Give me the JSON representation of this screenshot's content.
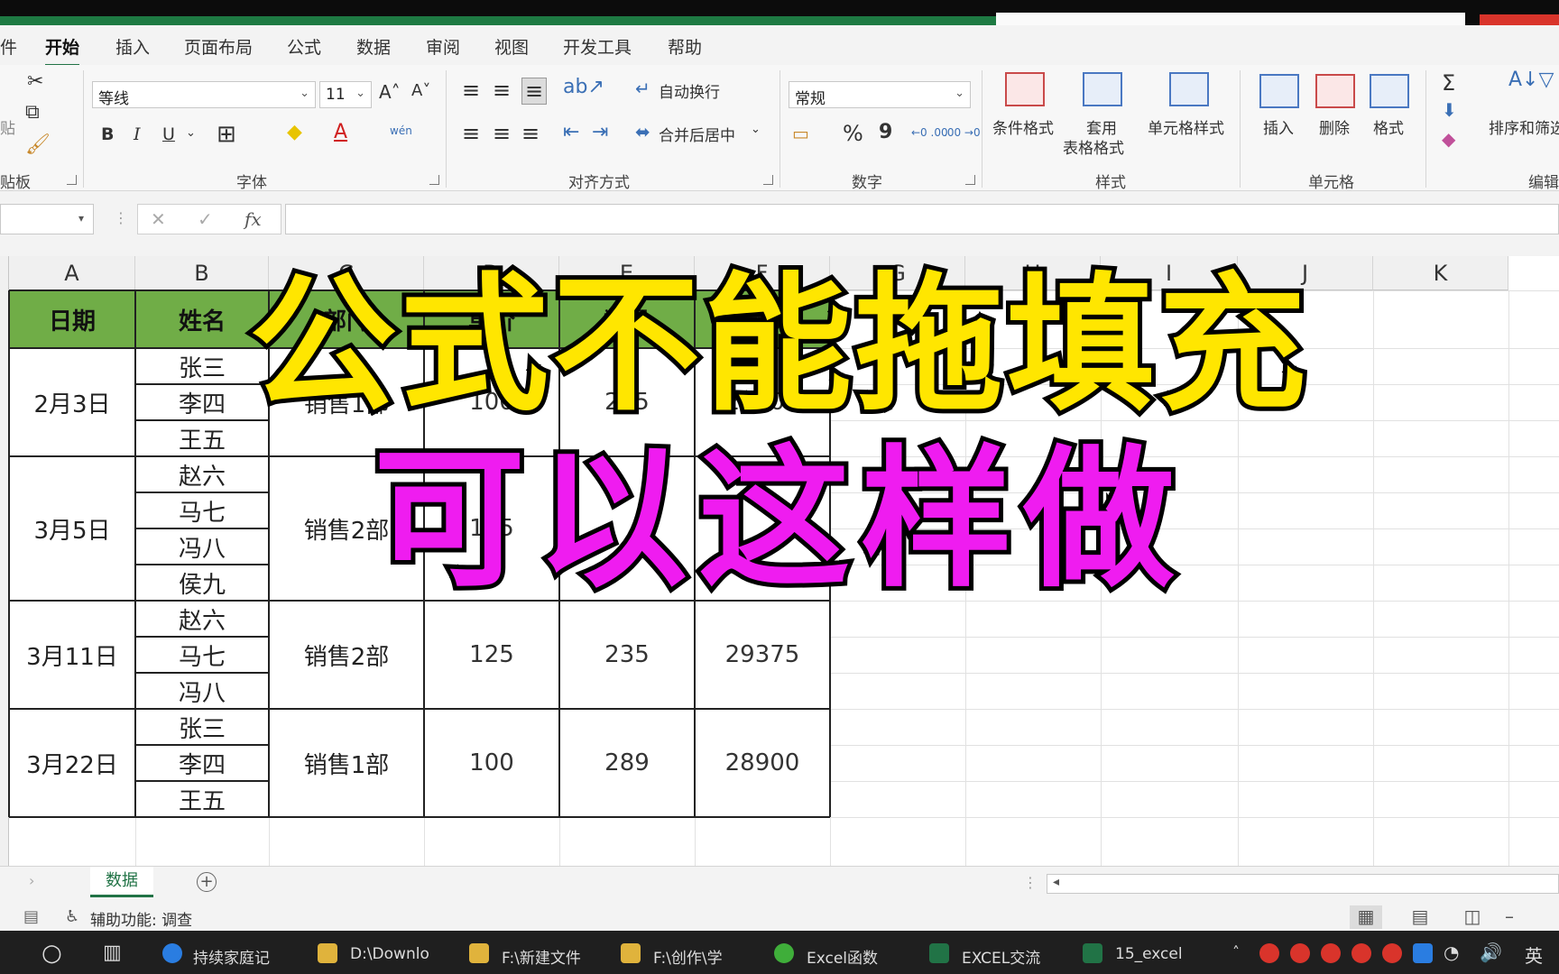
{
  "ribbon_tabs": [
    "件",
    "开始",
    "插入",
    "页面布局",
    "公式",
    "数据",
    "审阅",
    "视图",
    "开发工具",
    "帮助"
  ],
  "ribbon": {
    "clipboard": {
      "paste": "贴",
      "label": "贴板"
    },
    "font": {
      "name": "等线",
      "size": "11",
      "bold": "B",
      "italic": "I",
      "underline": "U",
      "grow": "A˄",
      "shrink": "A˅",
      "wen": "wén",
      "label": "字体"
    },
    "alignment": {
      "wrap": "自动换行",
      "merge": "合并后居中",
      "label": "对齐方式"
    },
    "number": {
      "format": "常规",
      "percent": "%",
      "comma": "9",
      "inc": "←0 .00",
      "dec": ".00 →0",
      "label": "数字"
    },
    "styles": {
      "cond": "条件格式",
      "table1": "套用",
      "table2": "表格格式",
      "cell": "单元格样式",
      "label": "样式"
    },
    "cells": {
      "insert": "插入",
      "delete": "删除",
      "format": "格式",
      "label": "单元格"
    },
    "editing": {
      "sort": "排序和筛选",
      "label": "编辑"
    }
  },
  "formula_bar": {
    "cancel": "✕",
    "confirm": "✓",
    "fx": "fx",
    "value": ""
  },
  "columns": [
    "A",
    "B",
    "C",
    "D",
    "E",
    "F",
    "G",
    "H",
    "I",
    "J",
    "K"
  ],
  "table": {
    "headers": [
      "日期",
      "姓名",
      "部门",
      "单价",
      "数量",
      "金额"
    ],
    "groups": [
      {
        "date": "2月3日",
        "names": [
          "张三",
          "李四",
          "王五"
        ],
        "dept": "销售1部",
        "price": "100",
        "qty": "255",
        "amount": "25500"
      },
      {
        "date": "3月5日",
        "names": [
          "赵六",
          "马七",
          "冯八",
          "侯九"
        ],
        "dept": "销售2部",
        "price": "125",
        "qty": "",
        "amount": ""
      },
      {
        "date": "3月11日",
        "names": [
          "赵六",
          "马七",
          "冯八"
        ],
        "dept": "销售2部",
        "price": "125",
        "qty": "235",
        "amount": "29375"
      },
      {
        "date": "3月22日",
        "names": [
          "张三",
          "李四",
          "王五"
        ],
        "dept": "销售1部",
        "price": "100",
        "qty": "289",
        "amount": "28900"
      }
    ]
  },
  "overlay": {
    "line1": "公式不能拖填充",
    "line2": "可以这样做"
  },
  "sheet_tabs": [
    "数据"
  ],
  "status": {
    "accessibility": "辅助功能: 调查"
  },
  "taskbar": [
    "持续家庭记",
    "D:\\Downlo",
    "F:\\新建文件",
    "F:\\创作\\学",
    "Excel函数",
    "EXCEL交流",
    "15_excel"
  ],
  "colors": {
    "header_green": "#70ad47",
    "accent": "#217346",
    "caption_yellow": "#ffe600",
    "caption_magenta": "#ef1cf0"
  }
}
